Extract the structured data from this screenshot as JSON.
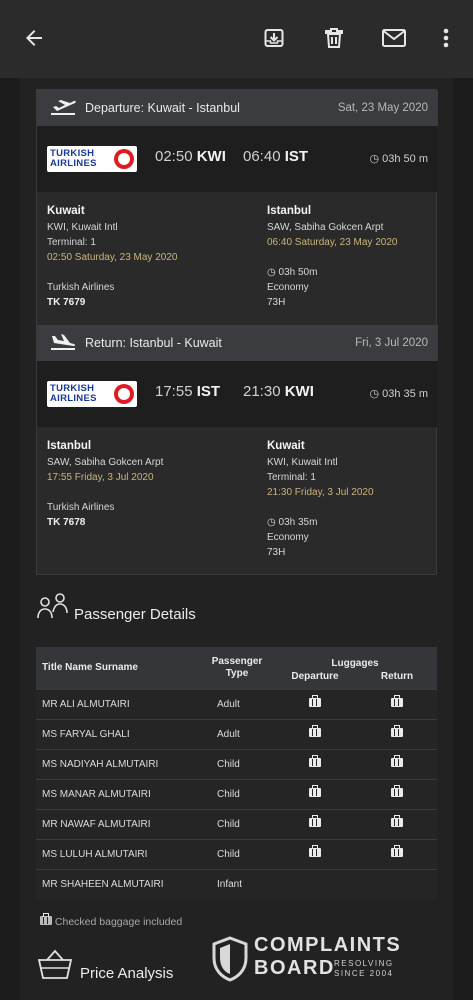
{
  "toolbar": {
    "icons": [
      "back-arrow-icon",
      "archive-icon",
      "delete-icon",
      "mail-icon",
      "more-vert-icon"
    ]
  },
  "departure": {
    "header_label": "Departure: Kuwait - Istanbul",
    "date": "Sat, 23 May 2020",
    "airline_logo": "TURKISH AIRLINES",
    "dep_time": "02:50",
    "dep_code": "KWI",
    "arr_time": "06:40",
    "arr_code": "IST",
    "duration": "03h 50 m",
    "from_city": "Kuwait",
    "from_airport": "KWI, Kuwait Intl",
    "from_terminal": "Terminal: 1",
    "from_datetime": "02:50 Saturday, 23 May 2020",
    "airline": "Turkish Airlines",
    "flight_no": "TK 7679",
    "to_city": "Istanbul",
    "to_airport": "SAW, Sabiha Gokcen Arpt",
    "to_datetime": "06:40 Saturday, 23 May 2020",
    "to_duration": "03h 50m",
    "cabin": "Economy",
    "class_code": "73H"
  },
  "return": {
    "header_label": "Return: Istanbul - Kuwait",
    "date": "Fri, 3 Jul 2020",
    "airline_logo": "TURKISH AIRLINES",
    "dep_time": "17:55",
    "dep_code": "IST",
    "arr_time": "21:30",
    "arr_code": "KWI",
    "duration": "03h 35 m",
    "from_city": "Istanbul",
    "from_airport": "SAW, Sabiha Gokcen Arpt",
    "from_datetime": "17:55 Friday, 3 Jul 2020",
    "airline": "Turkish Airlines",
    "flight_no": "TK 7678",
    "to_city": "Kuwait",
    "to_airport": "KWI, Kuwait Intl",
    "to_terminal": "Terminal: 1",
    "to_datetime": "21:30 Friday, 3 Jul 2020",
    "to_duration": "03h 35m",
    "cabin": "Economy",
    "class_code": "73H"
  },
  "passengers": {
    "title": "Passenger Details",
    "headers": {
      "name": "Title Name Surname",
      "type": "Passenger Type",
      "luggages": "Luggages",
      "departure": "Departure",
      "return": "Return"
    },
    "rows": [
      {
        "name": "MR ALI ALMUTAIRI",
        "type": "Adult",
        "dep_bag": true,
        "ret_bag": true
      },
      {
        "name": "MS FARYAL GHALI",
        "type": "Adult",
        "dep_bag": true,
        "ret_bag": true
      },
      {
        "name": "MS NADIYAH ALMUTAIRI",
        "type": "Child",
        "dep_bag": true,
        "ret_bag": true
      },
      {
        "name": "MS MANAR ALMUTAIRI",
        "type": "Child",
        "dep_bag": true,
        "ret_bag": true
      },
      {
        "name": "MR NAWAF ALMUTAIRI",
        "type": "Child",
        "dep_bag": true,
        "ret_bag": true
      },
      {
        "name": "MS LULUH ALMUTAIRI",
        "type": "Child",
        "dep_bag": true,
        "ret_bag": true
      },
      {
        "name": "MR SHAHEEN ALMUTAIRI",
        "type": "Infant",
        "dep_bag": false,
        "ret_bag": false
      }
    ],
    "note": "Checked baggage included"
  },
  "price": {
    "title": "Price Analysis"
  },
  "watermark": {
    "line1": "COMPLAINTS",
    "line2": "BOARD",
    "tag1": "RESOLVING",
    "tag2": "SINCE 2004"
  },
  "colors": {
    "background": "#1c1c1c",
    "card": "#2a2a2a",
    "header": "#3a3c40",
    "accent": "#c9b47a"
  }
}
